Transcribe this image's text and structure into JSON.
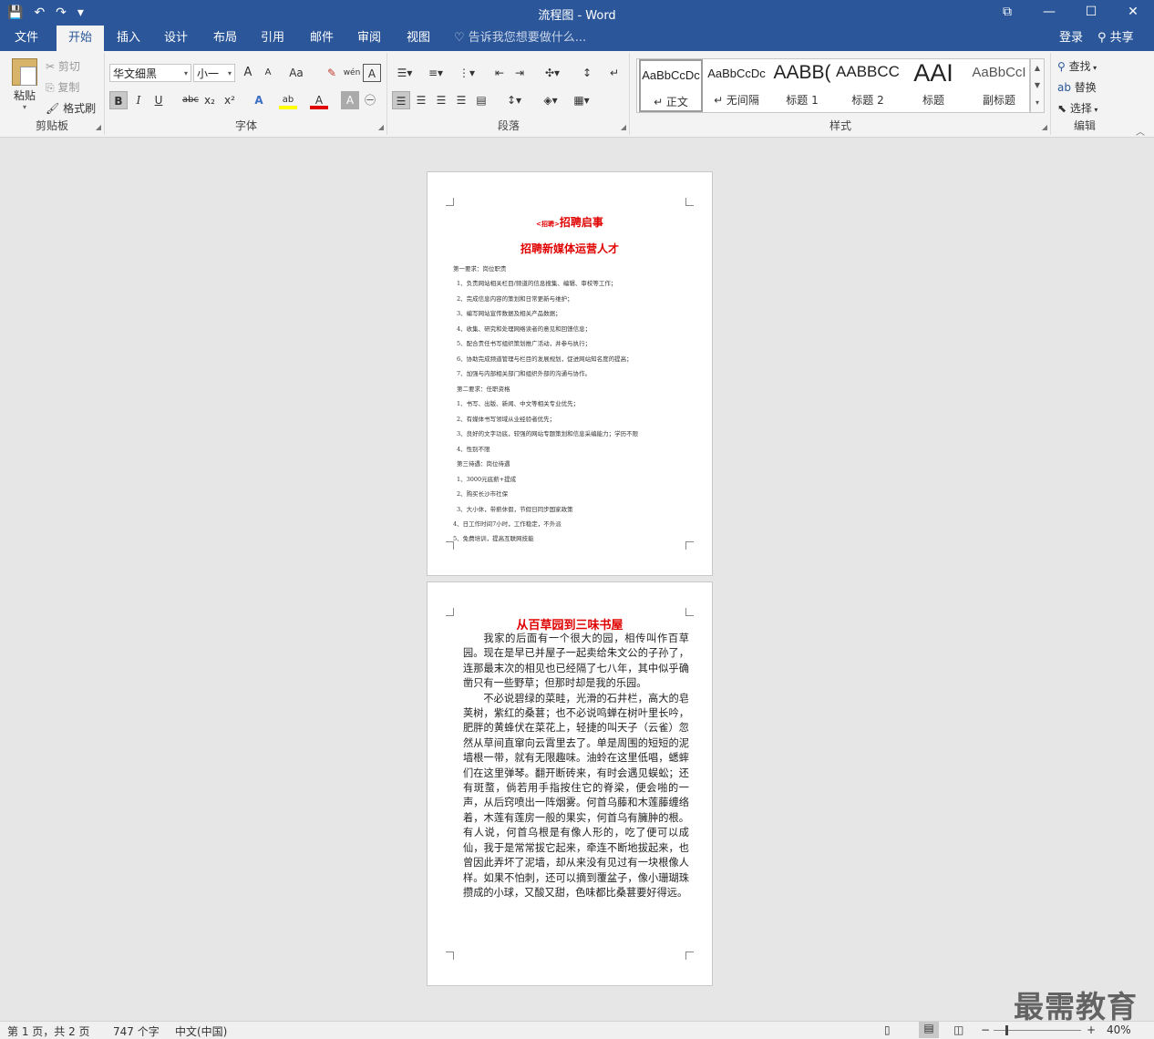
{
  "titlebar": {
    "title": "流程图 - Word",
    "save_icon": "💾",
    "undo_icon": "↶",
    "redo_icon": "↷",
    "qat_more": "▾",
    "restore_icon": "⧉",
    "minimize_icon": "—",
    "maximize_icon": "☐",
    "close_icon": "✕"
  },
  "tabs": [
    "文件",
    "开始",
    "插入",
    "设计",
    "布局",
    "引用",
    "邮件",
    "审阅",
    "视图"
  ],
  "tellme": "告诉我您想要做什么...",
  "login": "登录",
  "share": "共享",
  "clipboard": {
    "paste": "粘贴",
    "cut": "剪切",
    "copy": "复制",
    "format_painter": "格式刷",
    "label": "剪贴板"
  },
  "font": {
    "name": "华文细黑",
    "size": "小一",
    "grow": "A",
    "shrink": "A",
    "case": "Aa",
    "clear": "✎",
    "pinyin": "wén",
    "border": "A",
    "bold": "B",
    "italic": "I",
    "underline": "U",
    "strike": "abc",
    "sub": "x₂",
    "sup": "x²",
    "effects": "A",
    "highlight": "ab",
    "color": "A",
    "shading": "A",
    "circle": "㊀",
    "label": "字体"
  },
  "paragraph": {
    "label": "段落"
  },
  "styles": {
    "label": "样式",
    "items": [
      {
        "preview": "AaBbCcDc",
        "name": "↵ 正文"
      },
      {
        "preview": "AaBbCcDc",
        "name": "↵ 无间隔"
      },
      {
        "preview": "AABB(",
        "name": "标题 1"
      },
      {
        "preview": "AABBCC",
        "name": "标题 2"
      },
      {
        "preview": "AAI",
        "name": "标题"
      },
      {
        "preview": "AaBbCcI",
        "name": "副标题"
      }
    ]
  },
  "editing": {
    "find": "查找",
    "replace": "替换",
    "select": "选择",
    "label": "编辑"
  },
  "page1": {
    "logo": "<招聘>",
    "title1": "招聘启事",
    "title2": "招聘新媒体运营人才",
    "lines": [
      "第一要求：岗位职责",
      "1、负责网站相关栏目/频道的信息搜集、编辑、审校等工作；",
      "2、完成信息内容的策划和日常更新与维护；",
      "3、编写网站宣传数据及相关产品数据；",
      "4、收集、研究和处理网络读者的意见和回馈信息；",
      "5、配合责任书写组织策划推广活动，并参与执行；",
      "6、协助完成频道管理与栏目的发展规划，促进网站知名度的提高；",
      "7、加强与内部相关部门和组织外部的沟通与协作。",
      "第二要求：任职资格",
      "1、书写、出版、新闻、中文等相关专业优先；",
      "2、有媒体书写领域从业经验者优先；",
      "3、良好的文字功底，较强的网站专题策划和信息采编能力；学历不限",
      "4、性别不限",
      "第三待遇：岗位待遇",
      "1、3000元底薪+提成",
      "2、购买长沙市社保",
      "3、大小休，带薪休假，节假日同步国家政策",
      "4、日工作时间7小时，工作稳定，不外派",
      "5、免费培训，提高互联网技能"
    ]
  },
  "page2": {
    "title": "从百草园到三味书屋",
    "paragraphs": [
      "我家的后面有一个很大的园，相传叫作百草园。现在是早已并屋子一起卖给朱文公的子孙了，连那最末次的相见也已经隔了七八年，其中似乎确凿只有一些野草；但那时却是我的乐园。",
      "不必说碧绿的菜畦，光滑的石井栏，高大的皂荚树，紫红的桑葚；也不必说鸣蝉在树叶里长吟，肥胖的黄蜂伏在菜花上，轻捷的叫天子（云雀）忽然从草间直窜向云霄里去了。单是周围的短短的泥墙根一带，就有无限趣味。油蛉在这里低唱，蟋蟀们在这里弹琴。翻开断砖来，有时会遇见蜈蚣；还有斑蝥，倘若用手指按住它的脊梁，便会啪的一声，从后窍喷出一阵烟雾。何首乌藤和木莲藤缠络着，木莲有莲房一般的果实，何首乌有臃肿的根。有人说，何首乌根是有像人形的，吃了便可以成仙，我于是常常拔它起来，牵连不断地拔起来，也曾因此弄坏了泥墙，却从来没有见过有一块根像人样。如果不怕刺，还可以摘到覆盆子，像小珊瑚珠攒成的小球，又酸又甜，色味都比桑葚要好得远。"
    ]
  },
  "status": {
    "page": "第 1 页，共 2 页",
    "words": "747 个字",
    "lang": "中文(中国)",
    "zoom": "40%",
    "zoom_minus": "−",
    "zoom_plus": "+"
  },
  "watermark": "最需教育"
}
